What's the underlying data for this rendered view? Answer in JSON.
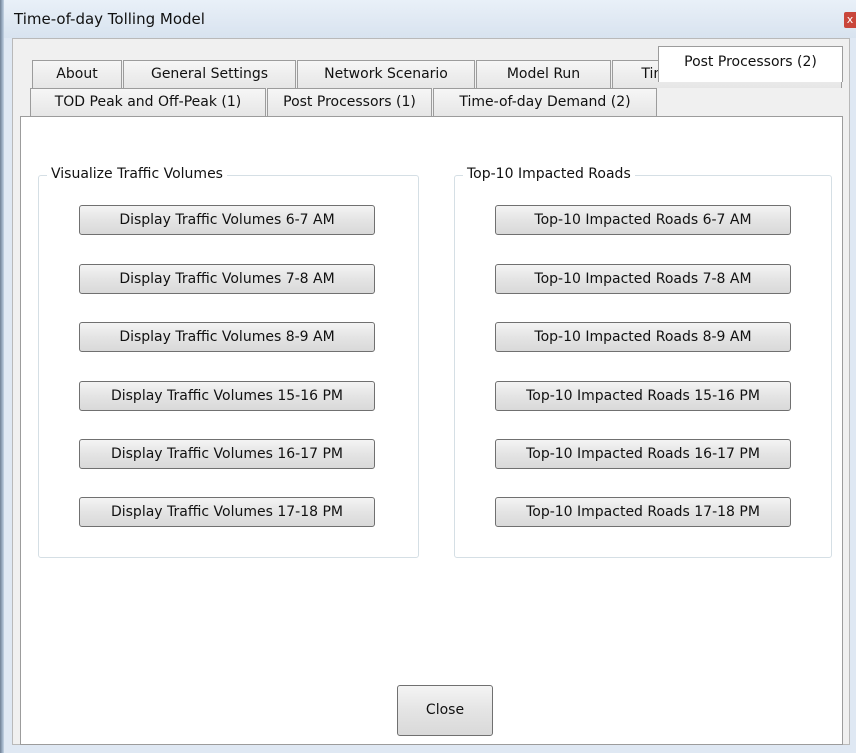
{
  "window": {
    "title": "Time-of-day Tolling Model",
    "close_glyph": "x"
  },
  "tabs": {
    "row1": [
      "About",
      "General Settings",
      "Network Scenario",
      "Model Run",
      "Time-of-day Demand (1)"
    ],
    "row2": [
      "TOD Peak and Off-Peak (1)",
      "Post Processors (1)",
      "Time-of-day Demand (2)",
      "Post Processors (2)"
    ],
    "active": "Post Processors (2)"
  },
  "panel": {
    "left_group": {
      "label": "Visualize Traffic Volumes",
      "buttons": [
        "Display Traffic Volumes 6-7 AM",
        "Display Traffic Volumes 7-8 AM",
        "Display Traffic Volumes 8-9 AM",
        "Display Traffic Volumes 15-16 PM",
        "Display Traffic Volumes 16-17 PM",
        "Display Traffic Volumes 17-18 PM"
      ]
    },
    "right_group": {
      "label": "Top-10 Impacted Roads",
      "buttons": [
        "Top-10 Impacted Roads 6-7 AM",
        "Top-10 Impacted Roads 7-8 AM",
        "Top-10 Impacted Roads 8-9 AM",
        "Top-10 Impacted Roads 15-16 PM",
        "Top-10 Impacted Roads 16-17 PM",
        "Top-10 Impacted Roads 17-18 PM"
      ]
    },
    "close_label": "Close"
  }
}
